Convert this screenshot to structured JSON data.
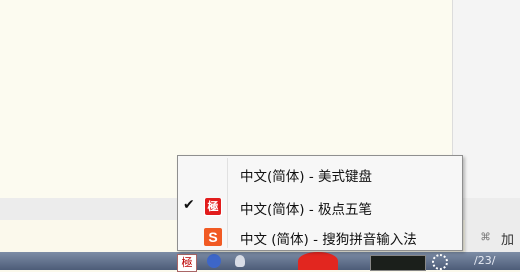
{
  "ime_menu": {
    "items": [
      {
        "label": "中文(简体) - 美式键盘",
        "checked": false,
        "icon": "none"
      },
      {
        "label": "中文(简体) - 极点五笔",
        "checked": true,
        "icon": "wubi-seal-icon",
        "icon_glyph": "極",
        "check_mark": "✔"
      },
      {
        "label": "中文 (简体) - 搜狗拼音输入法",
        "checked": false,
        "icon": "sogou-icon",
        "icon_glyph": "S"
      }
    ]
  },
  "side_toolbar": {
    "clip_glyph": "⌘",
    "label": "加"
  },
  "taskbar": {
    "ime_badge": "極",
    "clock_fragment": "/23/"
  },
  "colors": {
    "accent_red": "#e21d1d",
    "sogou_orange": "#f15a23",
    "menu_bg": "#f7f7f7"
  }
}
